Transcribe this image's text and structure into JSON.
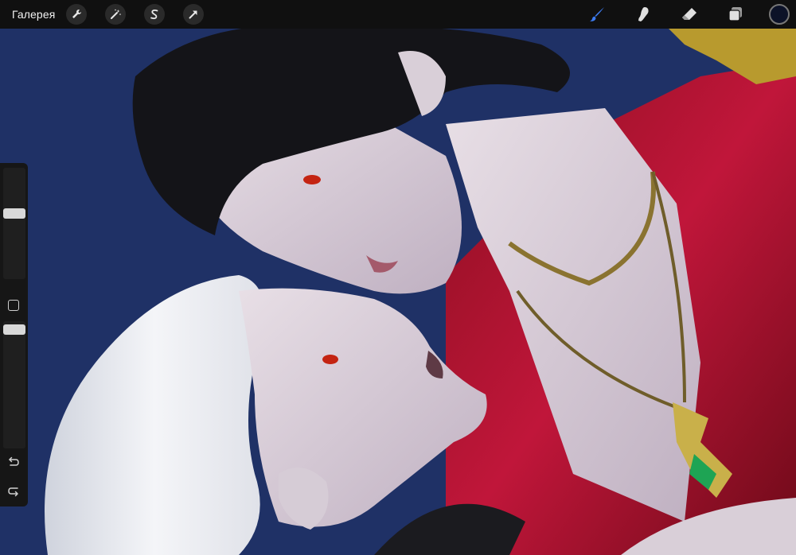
{
  "topbar": {
    "gallery_label": "Галерея",
    "actions": [
      {
        "name": "wrench-icon"
      },
      {
        "name": "magic-wand-icon"
      },
      {
        "name": "selection-icon"
      },
      {
        "name": "transform-arrow-icon"
      }
    ],
    "tools": [
      {
        "name": "brush-icon",
        "active": true
      },
      {
        "name": "smudge-icon",
        "active": false
      },
      {
        "name": "eraser-icon",
        "active": false
      },
      {
        "name": "layers-icon",
        "active": false
      }
    ],
    "active_color": "#0c1228",
    "accent_color": "#3d7bf0"
  },
  "sidebar": {
    "brush_size": 0.6,
    "opacity": 0.97,
    "modify_icon": "square-icon",
    "undo_icon": "undo-arrow-icon",
    "redo_icon": "redo-arrow-icon"
  },
  "canvas": {
    "background_color": "#1f3166",
    "artwork": "digital-painting"
  }
}
